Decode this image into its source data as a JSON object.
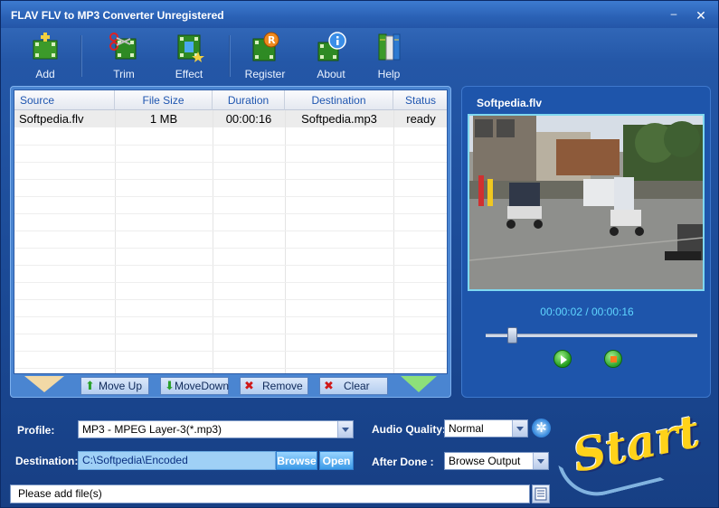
{
  "window": {
    "title": "FLAV FLV to MP3 Converter Unregistered",
    "minimize_glyph": "–",
    "close_glyph": "✕"
  },
  "toolbar": {
    "items": [
      {
        "label": "Add",
        "icon": "add-film-icon"
      },
      {
        "label": "Trim",
        "icon": "scissors-film-icon"
      },
      {
        "label": "Effect",
        "icon": "effect-film-icon"
      },
      {
        "label": "Register",
        "icon": "register-film-icon"
      },
      {
        "label": "About",
        "icon": "info-icon"
      },
      {
        "label": "Help",
        "icon": "help-book-icon"
      }
    ]
  },
  "file_list": {
    "columns": [
      "Source",
      "File Size",
      "Duration",
      "Destination",
      "Status"
    ],
    "rows": [
      {
        "source": "Softpedia.flv",
        "size": "1 MB",
        "duration": "00:00:16",
        "destination": "Softpedia.mp3",
        "status": "ready"
      }
    ],
    "buttons": {
      "move_up": "Move Up",
      "move_down": "MoveDown",
      "remove": "Remove",
      "clear": "Clear"
    }
  },
  "preview": {
    "filename": "Softpedia.flv",
    "time": "00:00:02 / 00:00:16",
    "position_fraction": 0.125
  },
  "settings": {
    "profile_label": "Profile:",
    "profile_value": "MP3 - MPEG Layer-3(*.mp3)",
    "destination_label": "Destination:",
    "destination_value": "C:\\Softpedia\\Encoded",
    "browse_label": "Browse",
    "open_label": "Open",
    "audio_quality_label": "Audio Quality:",
    "audio_quality_value": "Normal",
    "after_done_label": "After  Done :",
    "after_done_value": "Browse Output"
  },
  "start_label": "Start",
  "status": {
    "text": "Please  add  file(s)"
  },
  "colors": {
    "accent": "#1f56b0",
    "start_yellow": "#ffd21a",
    "time_cyan": "#5fd6ff"
  }
}
